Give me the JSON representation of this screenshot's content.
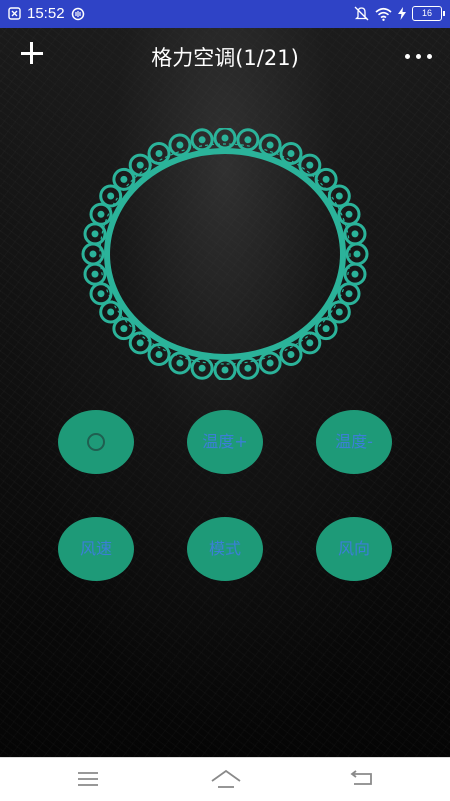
{
  "status_bar": {
    "time": "15:52",
    "battery_level": "16",
    "icons": [
      "app-notification-icon",
      "data-saver-icon",
      "mute-icon",
      "wifi-icon",
      "charging-icon",
      "battery-icon"
    ]
  },
  "header": {
    "title": "格力空调(1/21)",
    "add_icon": "plus-icon",
    "menu_icon": "more-dots-icon"
  },
  "remote": {
    "frame_color": "#2bb39a",
    "button_color": "#1e9a78",
    "label_color": "#3b7fd6",
    "buttons": [
      {
        "label": "",
        "icon": "power-icon"
      },
      {
        "label": "温度+"
      },
      {
        "label": "温度-"
      },
      {
        "label": "风速"
      },
      {
        "label": "模式"
      },
      {
        "label": "风向"
      }
    ]
  },
  "nav_bar": {
    "icons": [
      "menu-icon",
      "home-icon",
      "back-icon"
    ]
  }
}
